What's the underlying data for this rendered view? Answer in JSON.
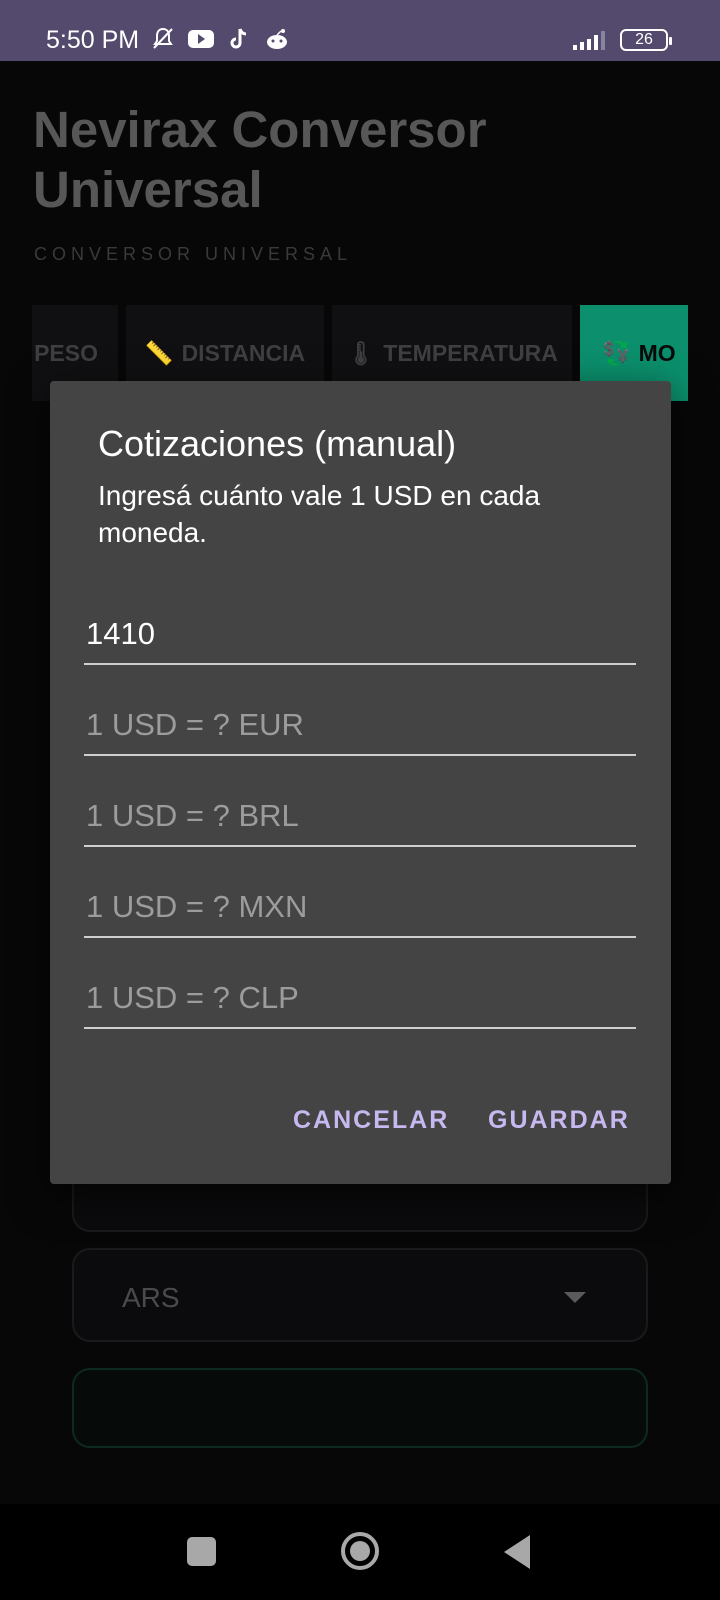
{
  "status_bar": {
    "time": "5:50 PM",
    "battery": "26",
    "icons": [
      "muted-notification-icon",
      "youtube-icon",
      "tiktok-icon",
      "reddit-icon"
    ]
  },
  "app": {
    "title": "Nevirax Conversor Universal",
    "subtitle": "CONVERSOR UNIVERSAL",
    "tabs": [
      {
        "label": "PESO",
        "icon": ""
      },
      {
        "label": "DISTANCIA",
        "icon": "📏"
      },
      {
        "label": "TEMPERATURA",
        "icon": "🌡"
      },
      {
        "label": "MO",
        "icon": "💱"
      }
    ],
    "currency_select": "ARS",
    "accent_color": "#0b8f6c"
  },
  "dialog": {
    "title": "Cotizaciones (manual)",
    "message": "Ingresá cuánto vale 1 USD en cada moneda.",
    "fields": [
      {
        "value": "1410",
        "placeholder": ""
      },
      {
        "value": "",
        "placeholder": "1 USD = ? EUR"
      },
      {
        "value": "",
        "placeholder": "1 USD = ? BRL"
      },
      {
        "value": "",
        "placeholder": "1 USD = ? MXN"
      },
      {
        "value": "",
        "placeholder": "1 USD = ? CLP"
      }
    ],
    "cancel_label": "CANCELAR",
    "save_label": "GUARDAR",
    "button_color": "#c7b8ef"
  }
}
